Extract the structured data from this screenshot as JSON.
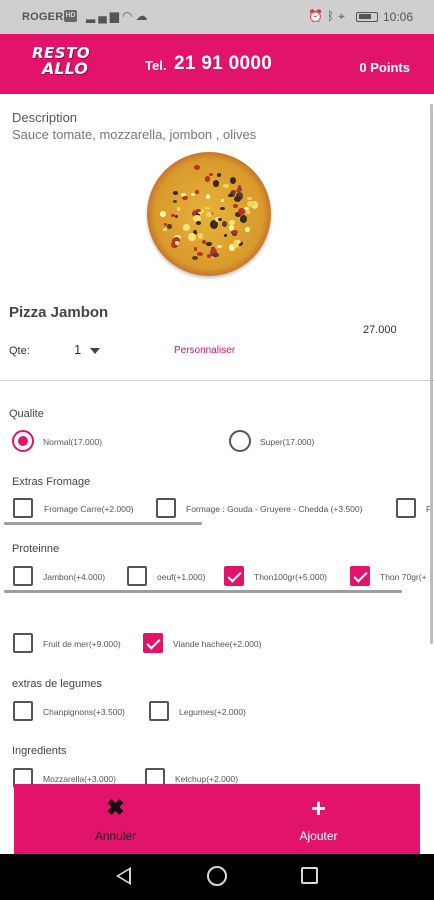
{
  "status_bar": {
    "carrier": "ROGERS",
    "network_badge": "HD",
    "left_icons": [
      "signal-icon",
      "wifi-icon",
      "cloud-icon"
    ],
    "right_icons": [
      "alarm-icon",
      "bluetooth-icon",
      "location-icon",
      "battery-icon"
    ],
    "time": "10:06"
  },
  "header": {
    "logo_line1": "RESTO",
    "logo_line2": "ALLO",
    "phone_prefix": "Tel.",
    "phone_number": "21 91 0000",
    "points": "0 Points",
    "color": "#e1136a"
  },
  "product": {
    "description_title": "Description",
    "description": "Sauce tomate, mozzarella, jombon , olives",
    "name": "Pizza Jambon",
    "price": "27.000",
    "qty_label": "Qte:",
    "qty_value": "1",
    "customize_link": "Personnaliser"
  },
  "sections": {
    "qualite": {
      "title": "Qualite",
      "options": [
        {
          "label": "Normal(17.000)",
          "selected": true
        },
        {
          "label": "Super(17.000)",
          "selected": false
        }
      ]
    },
    "extras_fromage": {
      "title": "Extras Fromage",
      "options": [
        {
          "label": "Fromage Carre(+2.000)",
          "checked": false
        },
        {
          "label": "Formage : Gouda - Gruyere - Chedda (+3.500)",
          "checked": false
        },
        {
          "label": "F",
          "checked": false
        }
      ]
    },
    "proteinne": {
      "title": "Proteinne",
      "options": [
        {
          "label": "Jambon(+4.000)",
          "checked": false
        },
        {
          "label": "oeuf(+1.000)",
          "checked": false
        },
        {
          "label": "Thon100gr(+5.000)",
          "checked": true
        },
        {
          "label": "Thon 70gr(+",
          "checked": true
        }
      ]
    },
    "proteinne_more": {
      "options": [
        {
          "label": "Fruit de mer(+9.000)",
          "checked": false
        },
        {
          "label": "Viande hachee(+2.000)",
          "checked": true
        }
      ]
    },
    "extras_legumes": {
      "title": "extras de legumes",
      "options": [
        {
          "label": "Chanpignons(+3.500)",
          "checked": false
        },
        {
          "label": "Legumes(+2.000)",
          "checked": false
        }
      ]
    },
    "ingredients": {
      "title": "Ingredients",
      "options": [
        {
          "label": "Mozzarella(+3.000)",
          "checked": false
        },
        {
          "label": "Ketchup(+2.000)",
          "checked": false
        }
      ]
    }
  },
  "actions": {
    "cancel_label": "Annuler",
    "add_label": "Ajouter",
    "cancel_icon": "close-icon",
    "add_icon": "plus-icon"
  },
  "nav": {
    "icons": [
      "back-icon",
      "home-icon",
      "recent-apps-icon"
    ]
  }
}
